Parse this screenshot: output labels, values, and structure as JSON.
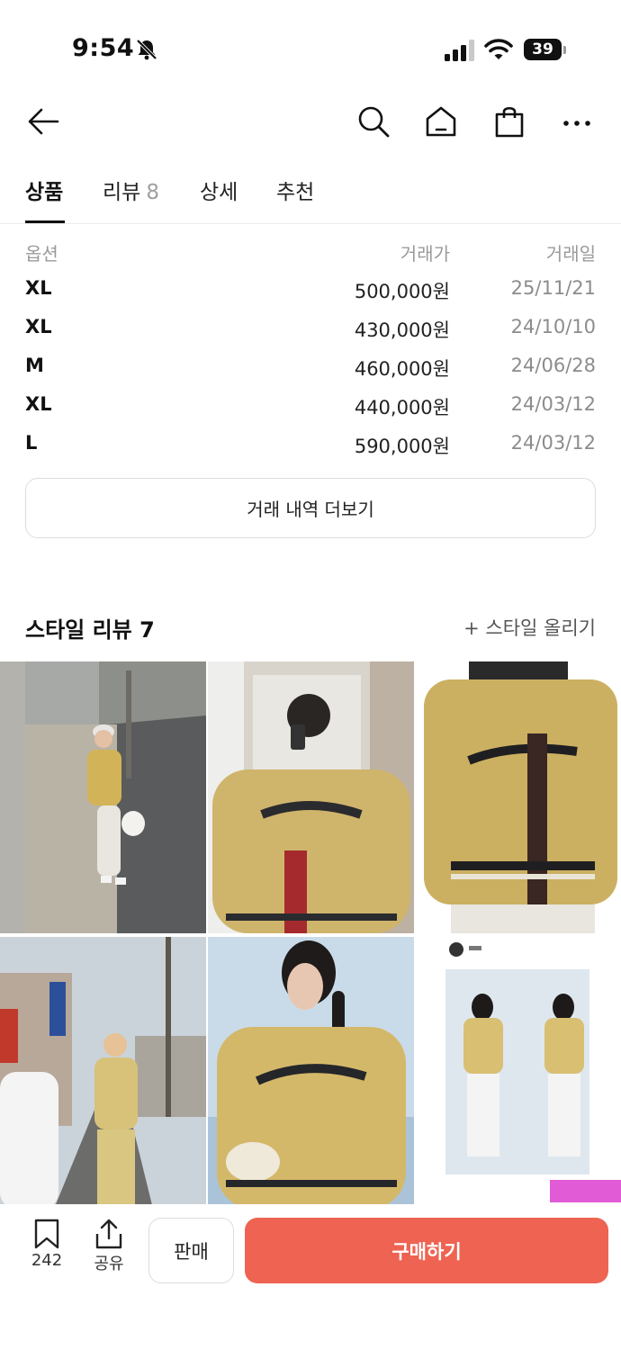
{
  "status_bar": {
    "time": "9:54",
    "battery": "39"
  },
  "nav": {
    "icons": [
      "back-arrow-icon",
      "search-icon",
      "home-icon",
      "shopping-bag-icon",
      "more-icon"
    ]
  },
  "tabs": [
    {
      "label": "상품",
      "count": ""
    },
    {
      "label": "리뷰",
      "count": "8"
    },
    {
      "label": "상세",
      "count": ""
    },
    {
      "label": "추천",
      "count": ""
    }
  ],
  "trade_history": {
    "headers": {
      "option": "옵션",
      "price": "거래가",
      "date": "거래일"
    },
    "rows": [
      {
        "option": "XL",
        "price": "500,000원",
        "date": "25/11/21"
      },
      {
        "option": "XL",
        "price": "430,000원",
        "date": "24/10/10"
      },
      {
        "option": "M",
        "price": "460,000원",
        "date": "24/06/28"
      },
      {
        "option": "XL",
        "price": "440,000원",
        "date": "24/03/12"
      },
      {
        "option": "L",
        "price": "590,000원",
        "date": "24/03/12"
      }
    ],
    "more_label": "거래 내역 더보기"
  },
  "style_review": {
    "title": "스타일 리뷰 7",
    "upload_label": "+ 스타일 올리기"
  },
  "bottom_bar": {
    "save_count": "242",
    "share_label": "공유",
    "sell_label": "판매",
    "buy_label": "구매하기"
  },
  "colors": {
    "accent": "#ee6352",
    "jacket": "#d8c07a"
  }
}
